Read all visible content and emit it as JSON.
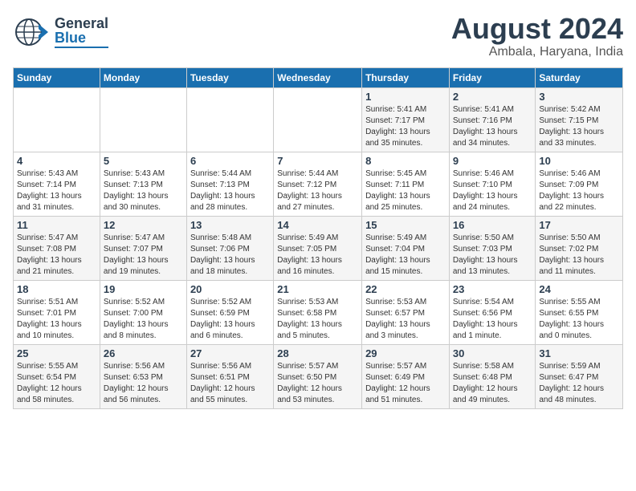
{
  "header": {
    "logo_general": "General",
    "logo_blue": "Blue",
    "title": "August 2024",
    "subtitle": "Ambala, Haryana, India"
  },
  "days_of_week": [
    "Sunday",
    "Monday",
    "Tuesday",
    "Wednesday",
    "Thursday",
    "Friday",
    "Saturday"
  ],
  "weeks": [
    [
      {
        "num": "",
        "info": ""
      },
      {
        "num": "",
        "info": ""
      },
      {
        "num": "",
        "info": ""
      },
      {
        "num": "",
        "info": ""
      },
      {
        "num": "1",
        "info": "Sunrise: 5:41 AM\nSunset: 7:17 PM\nDaylight: 13 hours\nand 35 minutes."
      },
      {
        "num": "2",
        "info": "Sunrise: 5:41 AM\nSunset: 7:16 PM\nDaylight: 13 hours\nand 34 minutes."
      },
      {
        "num": "3",
        "info": "Sunrise: 5:42 AM\nSunset: 7:15 PM\nDaylight: 13 hours\nand 33 minutes."
      }
    ],
    [
      {
        "num": "4",
        "info": "Sunrise: 5:43 AM\nSunset: 7:14 PM\nDaylight: 13 hours\nand 31 minutes."
      },
      {
        "num": "5",
        "info": "Sunrise: 5:43 AM\nSunset: 7:13 PM\nDaylight: 13 hours\nand 30 minutes."
      },
      {
        "num": "6",
        "info": "Sunrise: 5:44 AM\nSunset: 7:13 PM\nDaylight: 13 hours\nand 28 minutes."
      },
      {
        "num": "7",
        "info": "Sunrise: 5:44 AM\nSunset: 7:12 PM\nDaylight: 13 hours\nand 27 minutes."
      },
      {
        "num": "8",
        "info": "Sunrise: 5:45 AM\nSunset: 7:11 PM\nDaylight: 13 hours\nand 25 minutes."
      },
      {
        "num": "9",
        "info": "Sunrise: 5:46 AM\nSunset: 7:10 PM\nDaylight: 13 hours\nand 24 minutes."
      },
      {
        "num": "10",
        "info": "Sunrise: 5:46 AM\nSunset: 7:09 PM\nDaylight: 13 hours\nand 22 minutes."
      }
    ],
    [
      {
        "num": "11",
        "info": "Sunrise: 5:47 AM\nSunset: 7:08 PM\nDaylight: 13 hours\nand 21 minutes."
      },
      {
        "num": "12",
        "info": "Sunrise: 5:47 AM\nSunset: 7:07 PM\nDaylight: 13 hours\nand 19 minutes."
      },
      {
        "num": "13",
        "info": "Sunrise: 5:48 AM\nSunset: 7:06 PM\nDaylight: 13 hours\nand 18 minutes."
      },
      {
        "num": "14",
        "info": "Sunrise: 5:49 AM\nSunset: 7:05 PM\nDaylight: 13 hours\nand 16 minutes."
      },
      {
        "num": "15",
        "info": "Sunrise: 5:49 AM\nSunset: 7:04 PM\nDaylight: 13 hours\nand 15 minutes."
      },
      {
        "num": "16",
        "info": "Sunrise: 5:50 AM\nSunset: 7:03 PM\nDaylight: 13 hours\nand 13 minutes."
      },
      {
        "num": "17",
        "info": "Sunrise: 5:50 AM\nSunset: 7:02 PM\nDaylight: 13 hours\nand 11 minutes."
      }
    ],
    [
      {
        "num": "18",
        "info": "Sunrise: 5:51 AM\nSunset: 7:01 PM\nDaylight: 13 hours\nand 10 minutes."
      },
      {
        "num": "19",
        "info": "Sunrise: 5:52 AM\nSunset: 7:00 PM\nDaylight: 13 hours\nand 8 minutes."
      },
      {
        "num": "20",
        "info": "Sunrise: 5:52 AM\nSunset: 6:59 PM\nDaylight: 13 hours\nand 6 minutes."
      },
      {
        "num": "21",
        "info": "Sunrise: 5:53 AM\nSunset: 6:58 PM\nDaylight: 13 hours\nand 5 minutes."
      },
      {
        "num": "22",
        "info": "Sunrise: 5:53 AM\nSunset: 6:57 PM\nDaylight: 13 hours\nand 3 minutes."
      },
      {
        "num": "23",
        "info": "Sunrise: 5:54 AM\nSunset: 6:56 PM\nDaylight: 13 hours\nand 1 minute."
      },
      {
        "num": "24",
        "info": "Sunrise: 5:55 AM\nSunset: 6:55 PM\nDaylight: 13 hours\nand 0 minutes."
      }
    ],
    [
      {
        "num": "25",
        "info": "Sunrise: 5:55 AM\nSunset: 6:54 PM\nDaylight: 12 hours\nand 58 minutes."
      },
      {
        "num": "26",
        "info": "Sunrise: 5:56 AM\nSunset: 6:53 PM\nDaylight: 12 hours\nand 56 minutes."
      },
      {
        "num": "27",
        "info": "Sunrise: 5:56 AM\nSunset: 6:51 PM\nDaylight: 12 hours\nand 55 minutes."
      },
      {
        "num": "28",
        "info": "Sunrise: 5:57 AM\nSunset: 6:50 PM\nDaylight: 12 hours\nand 53 minutes."
      },
      {
        "num": "29",
        "info": "Sunrise: 5:57 AM\nSunset: 6:49 PM\nDaylight: 12 hours\nand 51 minutes."
      },
      {
        "num": "30",
        "info": "Sunrise: 5:58 AM\nSunset: 6:48 PM\nDaylight: 12 hours\nand 49 minutes."
      },
      {
        "num": "31",
        "info": "Sunrise: 5:59 AM\nSunset: 6:47 PM\nDaylight: 12 hours\nand 48 minutes."
      }
    ]
  ]
}
